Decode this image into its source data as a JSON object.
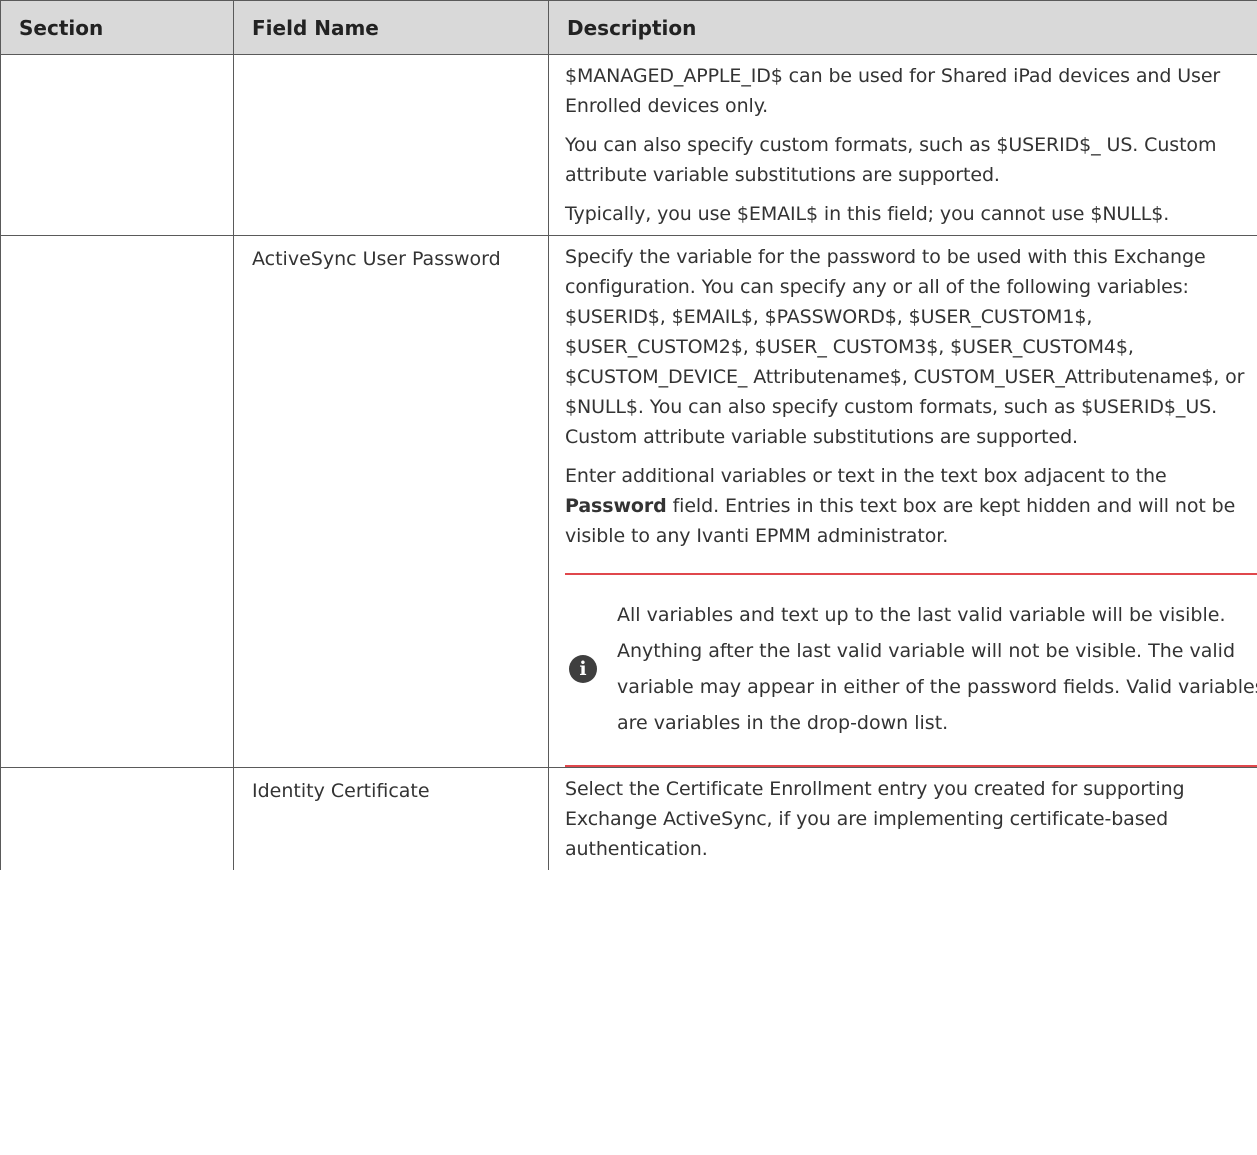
{
  "table": {
    "headers": {
      "section": "Section",
      "field_name": "Field Name",
      "description": "Description"
    },
    "rows": [
      {
        "section": "",
        "field_name": "",
        "paragraphs": [
          "$MANAGED_APPLE_ID$ can be used for Shared iPad devices and User Enrolled devices only.",
          "You can also specify custom formats, such as $USERID$_ US. Custom attribute variable substitutions are supported.",
          "Typically, you use $EMAIL$ in this field; you cannot use $NULL$."
        ]
      },
      {
        "section": "",
        "field_name": "ActiveSync User Password",
        "paragraphs": [
          "Specify the variable for the password to be used with this Exchange configuration. You can specify any or all of the following variables: $USERID$, $EMAIL$, $PASSWORD$, $USER_CUSTOM1$, $USER_CUSTOM2$, $USER_ CUSTOM3$, $USER_CUSTOM4$, $CUSTOM_DEVICE_ Attributename$, CUSTOM_USER_Attributename$, or $NULL$. You can also specify custom formats, such as $USERID$_US. Custom attribute variable substitutions are supported."
        ],
        "enter_text": {
          "before": "Enter additional variables or text in the text box adjacent to the ",
          "bold": "Password",
          "after": " field. Entries in this text box are kept hidden and will not be visible to any Ivanti EPMM administrator."
        },
        "note": {
          "icon": "info-icon",
          "text": "All variables and text up to the last valid variable will be visible. Anything after the last valid variable will not be visible. The valid variable may appear in either of the password fields. Valid variables are variables in the drop-down list.",
          "accent_color": "#e0474c"
        }
      },
      {
        "section": "",
        "field_name": "Identity Certificate",
        "paragraphs": [
          "Select the Certificate Enrollment entry you created for supporting Exchange ActiveSync, if you are implementing certificate-based authentication."
        ]
      }
    ]
  }
}
